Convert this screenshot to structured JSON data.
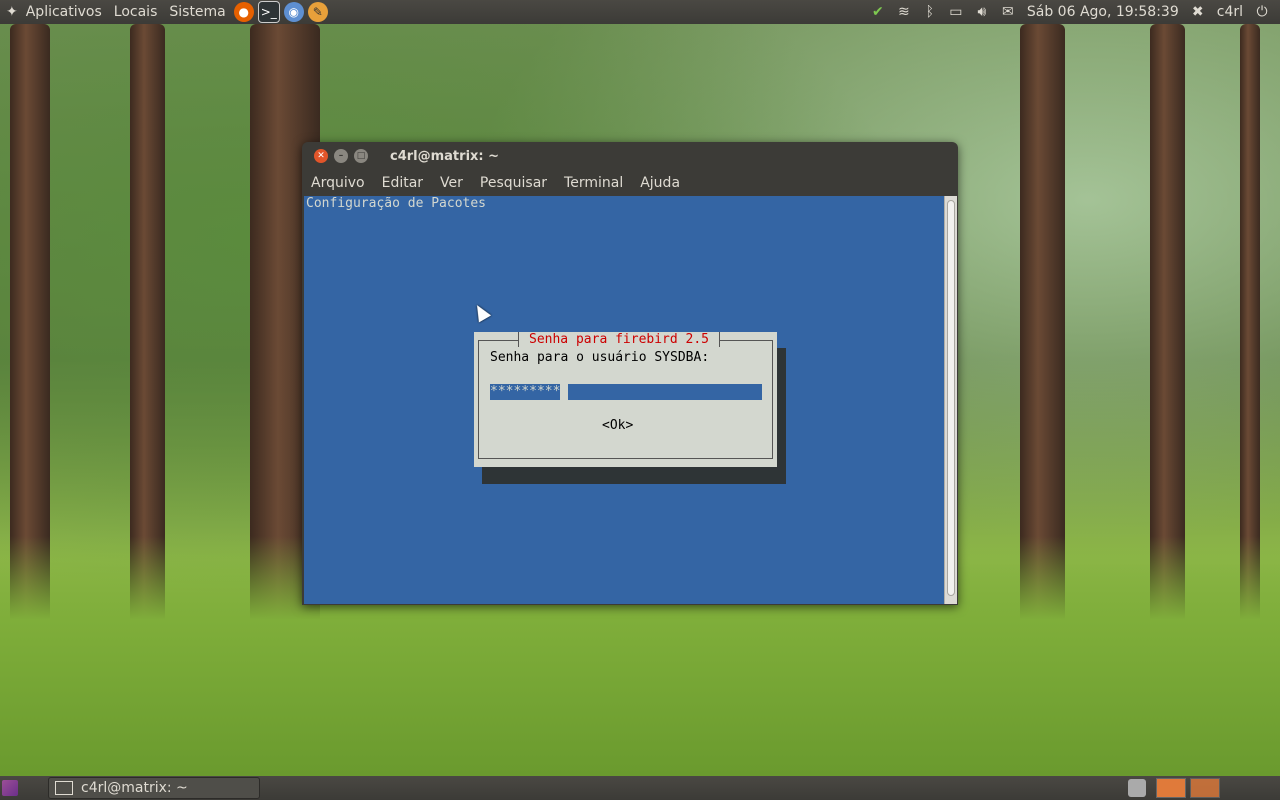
{
  "top_panel": {
    "menus": [
      "Aplicativos",
      "Locais",
      "Sistema"
    ],
    "launchers": [
      "firefox-icon",
      "terminal-icon",
      "chromium-icon",
      "gimp-icon"
    ],
    "tray_icons": [
      "update-shield-icon",
      "wifi-icon",
      "bluetooth-icon",
      "battery-icon",
      "volume-icon",
      "mail-icon"
    ],
    "clock": "Sáb 06 Ago, 19:58:39",
    "user": "c4rl"
  },
  "window": {
    "title": "c4rl@matrix: ~",
    "menu": [
      "Arquivo",
      "Editar",
      "Ver",
      "Pesquisar",
      "Terminal",
      "Ajuda"
    ]
  },
  "terminal": {
    "header": "Configuração de Pacotes",
    "dialog": {
      "title": "Senha para firebird 2.5",
      "label": "Senha para o usuário SYSDBA:",
      "password_mask": "*********",
      "ok": "<Ok>"
    }
  },
  "bottom_panel": {
    "task_title": "c4rl@matrix: ~"
  },
  "colors": {
    "panel": "#3c3b37",
    "terminal_bg": "#3465a4",
    "dialog_bg": "#d3d7cf",
    "dialog_title": "#cc0000",
    "close_button": "#e2552a"
  }
}
